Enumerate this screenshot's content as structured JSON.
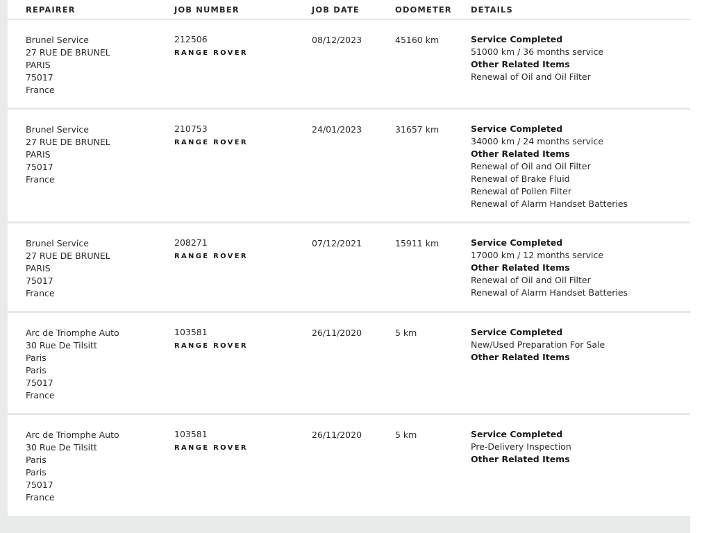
{
  "columns": {
    "repairer": "REPAIRER",
    "job_number": "JOB NUMBER",
    "job_date": "JOB DATE",
    "odometer": "ODOMETER",
    "details": "DETAILS"
  },
  "rows": [
    {
      "repairer": [
        "Brunel Service",
        "27 RUE DE BRUNEL",
        "PARIS",
        "75017",
        "France"
      ],
      "job_number": "212506",
      "brand": "RANGE ROVER",
      "job_date": "08/12/2023",
      "odometer": "45160 km",
      "details": [
        {
          "text": "Service Completed",
          "bold": true
        },
        {
          "text": "51000 km / 36 months service",
          "bold": false
        },
        {
          "text": "Other Related Items",
          "bold": true
        },
        {
          "text": "Renewal of Oil and Oil Filter",
          "bold": false
        }
      ]
    },
    {
      "repairer": [
        "Brunel Service",
        "27 RUE DE BRUNEL",
        "PARIS",
        "75017",
        "France"
      ],
      "job_number": "210753",
      "brand": "RANGE ROVER",
      "job_date": "24/01/2023",
      "odometer": "31657 km",
      "details": [
        {
          "text": "Service Completed",
          "bold": true
        },
        {
          "text": "34000 km / 24 months service",
          "bold": false
        },
        {
          "text": "Other Related Items",
          "bold": true
        },
        {
          "text": "Renewal of Oil and Oil Filter",
          "bold": false
        },
        {
          "text": "Renewal of Brake Fluid",
          "bold": false
        },
        {
          "text": "Renewal of Pollen Filter",
          "bold": false
        },
        {
          "text": "Renewal of Alarm Handset Batteries",
          "bold": false
        }
      ]
    },
    {
      "repairer": [
        "Brunel Service",
        "27 RUE DE BRUNEL",
        "PARIS",
        "75017",
        "France"
      ],
      "job_number": "208271",
      "brand": "RANGE ROVER",
      "job_date": "07/12/2021",
      "odometer": "15911 km",
      "details": [
        {
          "text": "Service Completed",
          "bold": true
        },
        {
          "text": "17000 km / 12 months service",
          "bold": false
        },
        {
          "text": "Other Related Items",
          "bold": true
        },
        {
          "text": "Renewal of Oil and Oil Filter",
          "bold": false
        },
        {
          "text": "Renewal of Alarm Handset Batteries",
          "bold": false
        }
      ]
    },
    {
      "repairer": [
        "Arc de Triomphe Auto",
        "30 Rue De Tilsitt",
        "Paris",
        "Paris",
        "75017",
        "France"
      ],
      "job_number": "103581",
      "brand": "RANGE ROVER",
      "job_date": "26/11/2020",
      "odometer": "5 km",
      "details": [
        {
          "text": "Service Completed",
          "bold": true
        },
        {
          "text": "New/Used Preparation For Sale",
          "bold": false
        },
        {
          "text": "Other Related Items",
          "bold": true
        }
      ]
    },
    {
      "repairer": [
        "Arc de Triomphe Auto",
        "30 Rue De Tilsitt",
        "Paris",
        "Paris",
        "75017",
        "France"
      ],
      "job_number": "103581",
      "brand": "RANGE ROVER",
      "job_date": "26/11/2020",
      "odometer": "5 km",
      "details": [
        {
          "text": "Service Completed",
          "bold": true
        },
        {
          "text": "Pre-Delivery Inspection",
          "bold": false
        },
        {
          "text": "Other Related Items",
          "bold": true
        }
      ]
    }
  ]
}
